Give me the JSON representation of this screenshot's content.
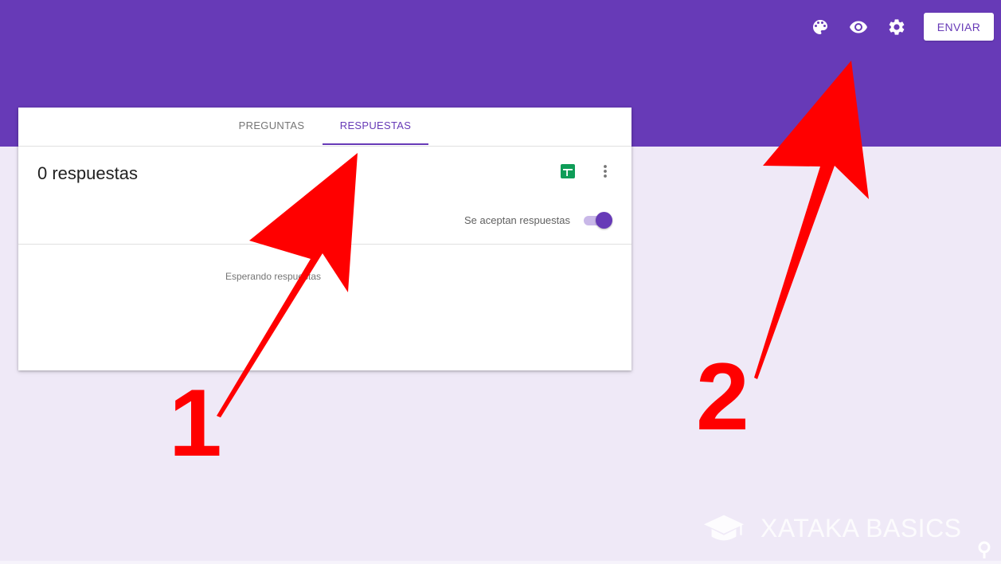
{
  "colors": {
    "header": "#673ab7",
    "background": "#efe9f7",
    "accent": "#673ab7",
    "annotation": "#ff0000",
    "sheets": "#0f9d58"
  },
  "toolbar": {
    "icons": [
      "palette-icon",
      "eye-icon",
      "gear-icon"
    ],
    "send_label": "ENVIAR"
  },
  "tabs": [
    {
      "label": "PREGUNTAS",
      "active": false
    },
    {
      "label": "RESPUESTAS",
      "active": true
    }
  ],
  "responses": {
    "count_label": "0 respuestas",
    "accepting_label": "Se aceptan respuestas",
    "accepting": true,
    "waiting_label": "Esperando respuestas"
  },
  "annotations": {
    "marker_1": "1",
    "marker_2": "2"
  },
  "watermark": {
    "text": "XATAKA BASICS"
  }
}
